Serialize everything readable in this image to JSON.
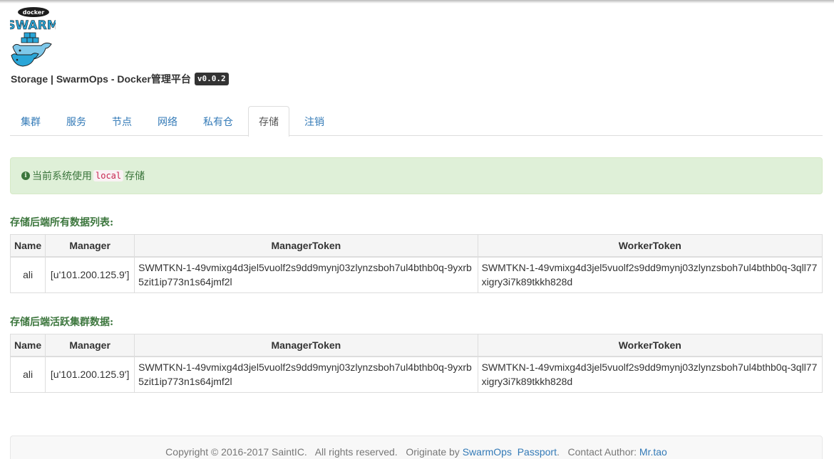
{
  "header": {
    "logo_text": "docker",
    "logo_word": "SWARM",
    "title": "Storage | SwarmOps - Docker管理平台",
    "version": "v0.0.2"
  },
  "tabs": [
    {
      "label": "集群",
      "active": false
    },
    {
      "label": "服务",
      "active": false
    },
    {
      "label": "节点",
      "active": false
    },
    {
      "label": "网络",
      "active": false
    },
    {
      "label": "私有仓",
      "active": false
    },
    {
      "label": "存储",
      "active": true
    },
    {
      "label": "注销",
      "active": false
    }
  ],
  "alert": {
    "icon": "info-circle-icon",
    "prefix": "当前系统使用",
    "code": "local",
    "suffix": "存储"
  },
  "sections": [
    {
      "title": "存储后端所有数据列表:",
      "columns": [
        "Name",
        "Manager",
        "ManagerToken",
        "WorkerToken"
      ],
      "rows": [
        {
          "name": "ali",
          "manager": "[u'101.200.125.9']",
          "manager_token": "SWMTKN-1-49vmixg4d3jel5vuolf2s9dd9mynj03zlynzsboh7ul4bthb0q-9yxrb5zit1ip773n1s64jmf2l",
          "worker_token": "SWMTKN-1-49vmixg4d3jel5vuolf2s9dd9mynj03zlynzsboh7ul4bthb0q-3qll77xigry3i7k89tkkh828d"
        }
      ]
    },
    {
      "title": "存储后端活跃集群数据:",
      "columns": [
        "Name",
        "Manager",
        "ManagerToken",
        "WorkerToken"
      ],
      "rows": [
        {
          "name": "ali",
          "manager": "[u'101.200.125.9']",
          "manager_token": "SWMTKN-1-49vmixg4d3jel5vuolf2s9dd9mynj03zlynzsboh7ul4bthb0q-9yxrb5zit1ip773n1s64jmf2l",
          "worker_token": "SWMTKN-1-49vmixg4d3jel5vuolf2s9dd9mynj03zlynzsboh7ul4bthb0q-3qll77xigry3i7k89tkkh828d"
        }
      ]
    }
  ],
  "footer": {
    "copyright": "Copyright © 2016-2017 SaintIC.   All rights reserved.   Originate by ",
    "link_swarmops": "SwarmOps",
    "link_passport": "Passport",
    "separator": ".   Contact Author: ",
    "link_author": "Mr.tao"
  },
  "colors": {
    "link": "#337ab7",
    "alert_bg": "#dff0d8",
    "alert_text": "#3c763d",
    "badge_bg": "#333333"
  }
}
